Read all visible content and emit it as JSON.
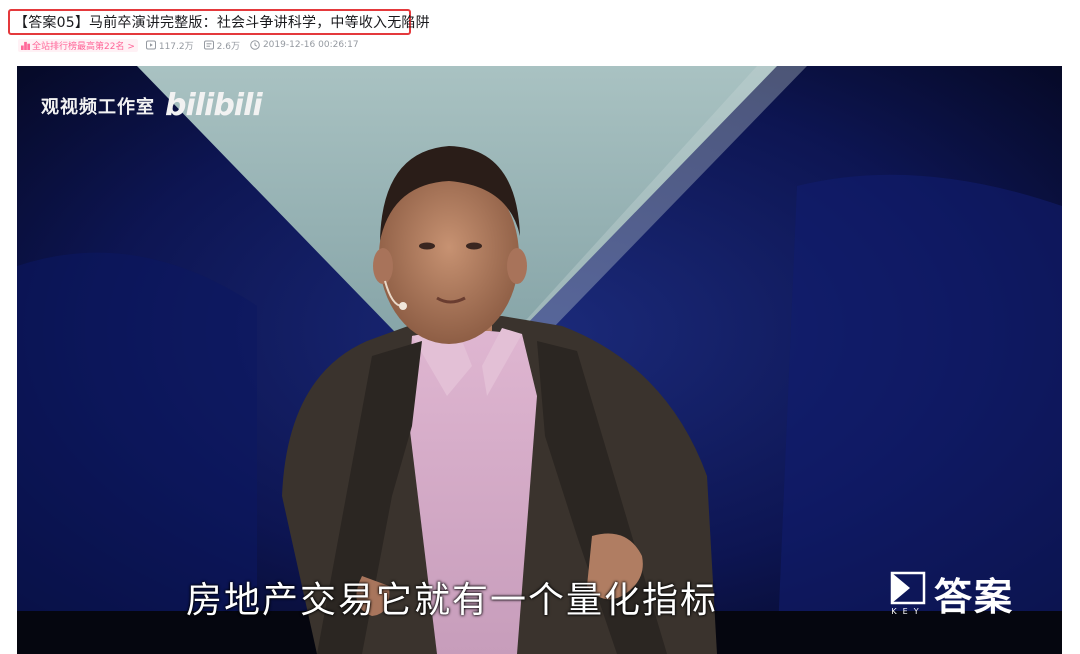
{
  "header": {
    "title": "【答案05】马前卒演讲完整版：社会斗争讲科学，中等收入无陷阱"
  },
  "meta": {
    "rank_label": "全站排行榜最高第22名 >",
    "views": "117.2万",
    "danmaku": "2.6万",
    "timestamp": "2019-12-16 00:26:17"
  },
  "player": {
    "watermark_text": "观视频工作室",
    "watermark_logo": "bilibili",
    "subtitle": "房地产交易它就有一个量化指标",
    "brand_key": "KEY",
    "brand_text": "答案"
  },
  "colors": {
    "highlight_border": "#e4393c",
    "rank_pink": "#ff6699",
    "meta_gray": "#9499a0"
  }
}
